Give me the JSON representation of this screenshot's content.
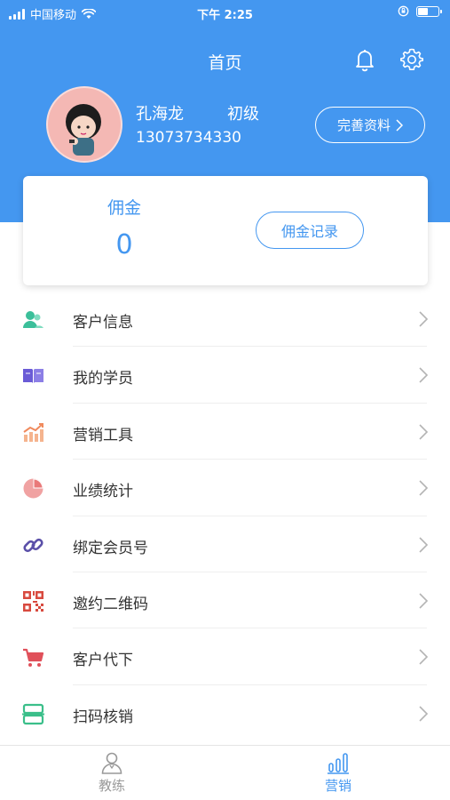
{
  "status_bar": {
    "carrier": "中国移动",
    "time": "下午 2:25"
  },
  "nav": {
    "title": "首页"
  },
  "profile": {
    "name": "孔海龙",
    "level": "初级",
    "phone": "13073734330",
    "edit_label": "完善资料"
  },
  "commission": {
    "label": "佣金",
    "value": "0",
    "records_label": "佣金记录"
  },
  "menu": {
    "items": [
      {
        "label": "客户信息",
        "icon": "customer-icon",
        "color": "#3bbf9a"
      },
      {
        "label": "我的学员",
        "icon": "book-icon",
        "color": "#6a5bd6"
      },
      {
        "label": "营销工具",
        "icon": "chart-icon",
        "color": "#f08a5d"
      },
      {
        "label": "业绩统计",
        "icon": "pie-icon",
        "color": "#e97979"
      },
      {
        "label": "绑定会员号",
        "icon": "link-icon",
        "color": "#5a4fa8"
      },
      {
        "label": "邀约二维码",
        "icon": "qrcode-icon",
        "color": "#d84a3f"
      },
      {
        "label": "客户代下",
        "icon": "cart-icon",
        "color": "#e0505a"
      },
      {
        "label": "扫码核销",
        "icon": "scan-icon",
        "color": "#3bbf8a"
      }
    ]
  },
  "tabbar": {
    "tabs": [
      {
        "label": "教练",
        "active": false
      },
      {
        "label": "营销",
        "active": true
      }
    ]
  },
  "colors": {
    "primary": "#4497f0",
    "inactive": "#999999"
  }
}
